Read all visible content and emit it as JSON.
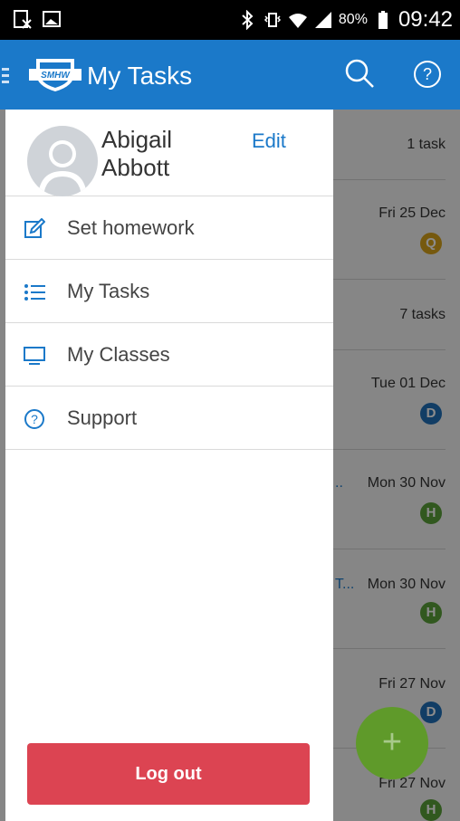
{
  "status_bar": {
    "battery": "80%",
    "time": "09:42"
  },
  "app_bar": {
    "title": "My Tasks",
    "logo_text": "SMHW"
  },
  "drawer": {
    "user": {
      "first_name": "Abigail",
      "last_name": "Abbott"
    },
    "edit_label": "Edit",
    "items": [
      {
        "label": "Set homework",
        "icon": "edit-icon"
      },
      {
        "label": "My Tasks",
        "icon": "list-icon"
      },
      {
        "label": "My Classes",
        "icon": "monitor-icon"
      },
      {
        "label": "Support",
        "icon": "help-icon"
      }
    ],
    "logout_label": "Log out"
  },
  "tasks": [
    {
      "date": "1 task",
      "badge": "",
      "trunc": ""
    },
    {
      "date": "Fri 25 Dec",
      "badge": "Q",
      "trunc": ""
    },
    {
      "date": "7 tasks",
      "badge": "",
      "trunc": ""
    },
    {
      "date": "Tue 01 Dec",
      "badge": "D",
      "trunc": ""
    },
    {
      "date": "Mon 30 Nov",
      "badge": "H",
      "trunc": ".."
    },
    {
      "date": "Mon 30 Nov",
      "badge": "H",
      "trunc": "T..."
    },
    {
      "date": "Fri 27 Nov",
      "badge": "D",
      "trunc": ""
    },
    {
      "date": "Fri 27 Nov",
      "badge": "H",
      "trunc": ""
    }
  ],
  "colors": {
    "primary": "#1b79c9",
    "logout": "#dc4452",
    "badge_q": "#d8a21b",
    "badge_d": "#1f6fb8",
    "badge_h": "#5aa03a",
    "fab": "#7bbf3a"
  },
  "fab_icon": "+"
}
